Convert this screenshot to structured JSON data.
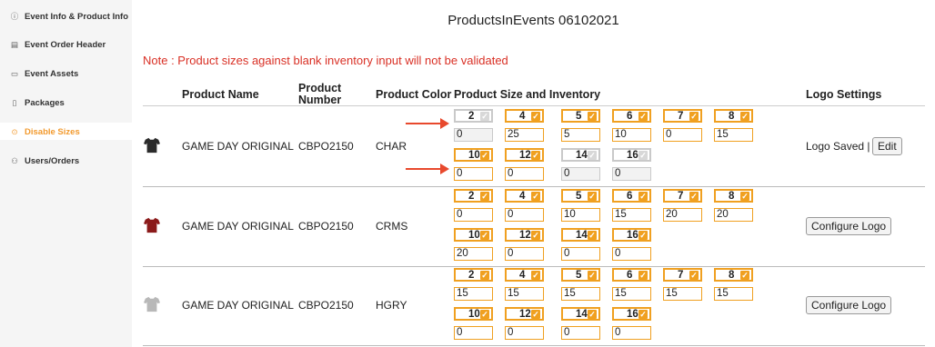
{
  "sidebar": {
    "items": [
      {
        "icon": "ⓘ",
        "label": "Event Info & Product Info"
      },
      {
        "icon": "▤",
        "label": "Event Order Header"
      },
      {
        "icon": "▭",
        "label": "Event Assets"
      },
      {
        "icon": "▯",
        "label": "Packages"
      },
      {
        "icon": "⊙",
        "label": "Disable Sizes"
      },
      {
        "icon": "⚇",
        "label": "Users/Orders"
      }
    ]
  },
  "page": {
    "title": "ProductsInEvents 06102021",
    "note": "Note : Product sizes against blank inventory input will not be validated"
  },
  "table": {
    "headers": {
      "name": "Product Name",
      "number_line1": "Product",
      "number_line2": "Number",
      "color": "Product Color",
      "sizes": "Product Size and Inventory",
      "logo": "Logo Settings"
    },
    "rows": [
      {
        "name": "GAME DAY ORIGINAL",
        "number": "CBPO2150",
        "color": "CHAR",
        "sizes_row1": [
          {
            "size": "2",
            "checked": false,
            "inv": "0"
          },
          {
            "size": "4",
            "checked": true,
            "inv": "25"
          },
          {
            "size": "5",
            "checked": true,
            "inv": "5"
          },
          {
            "size": "6",
            "checked": true,
            "inv": "10"
          },
          {
            "size": "7",
            "checked": true,
            "inv": "0"
          },
          {
            "size": "8",
            "checked": true,
            "inv": "15"
          }
        ],
        "sizes_row2": [
          {
            "size": "10",
            "checked": true,
            "inv": "0"
          },
          {
            "size": "12",
            "checked": true,
            "inv": "0"
          },
          {
            "size": "14",
            "checked": false,
            "inv": "0"
          },
          {
            "size": "16",
            "checked": false,
            "inv": "0"
          }
        ],
        "logo_saved": "Logo Saved |",
        "logo_button": "Edit"
      },
      {
        "name": "GAME DAY ORIGINAL",
        "number": "CBPO2150",
        "color": "CRMS",
        "sizes_row1": [
          {
            "size": "2",
            "checked": true,
            "inv": "0"
          },
          {
            "size": "4",
            "checked": true,
            "inv": "0"
          },
          {
            "size": "5",
            "checked": true,
            "inv": "10"
          },
          {
            "size": "6",
            "checked": true,
            "inv": "15"
          },
          {
            "size": "7",
            "checked": true,
            "inv": "20"
          },
          {
            "size": "8",
            "checked": true,
            "inv": "20"
          }
        ],
        "sizes_row2": [
          {
            "size": "10",
            "checked": true,
            "inv": "20"
          },
          {
            "size": "12",
            "checked": true,
            "inv": "0"
          },
          {
            "size": "14",
            "checked": true,
            "inv": "0"
          },
          {
            "size": "16",
            "checked": true,
            "inv": "0"
          }
        ],
        "logo_saved": "",
        "logo_button": "Configure Logo"
      },
      {
        "name": "GAME DAY ORIGINAL",
        "number": "CBPO2150",
        "color": "HGRY",
        "sizes_row1": [
          {
            "size": "2",
            "checked": true,
            "inv": "15"
          },
          {
            "size": "4",
            "checked": true,
            "inv": "15"
          },
          {
            "size": "5",
            "checked": true,
            "inv": "15"
          },
          {
            "size": "6",
            "checked": true,
            "inv": "15"
          },
          {
            "size": "7",
            "checked": true,
            "inv": "15"
          },
          {
            "size": "8",
            "checked": true,
            "inv": "15"
          }
        ],
        "sizes_row2": [
          {
            "size": "10",
            "checked": true,
            "inv": "0"
          },
          {
            "size": "12",
            "checked": true,
            "inv": "0"
          },
          {
            "size": "14",
            "checked": true,
            "inv": "0"
          },
          {
            "size": "16",
            "checked": true,
            "inv": "0"
          }
        ],
        "logo_saved": "",
        "logo_button": "Configure Logo"
      }
    ]
  },
  "colors": {
    "accent": "#f29a2e",
    "note": "#d93025",
    "shirt_char": "#2b2b2b",
    "shirt_crms": "#8b1a1a",
    "shirt_hgry": "#b8b8b8"
  }
}
